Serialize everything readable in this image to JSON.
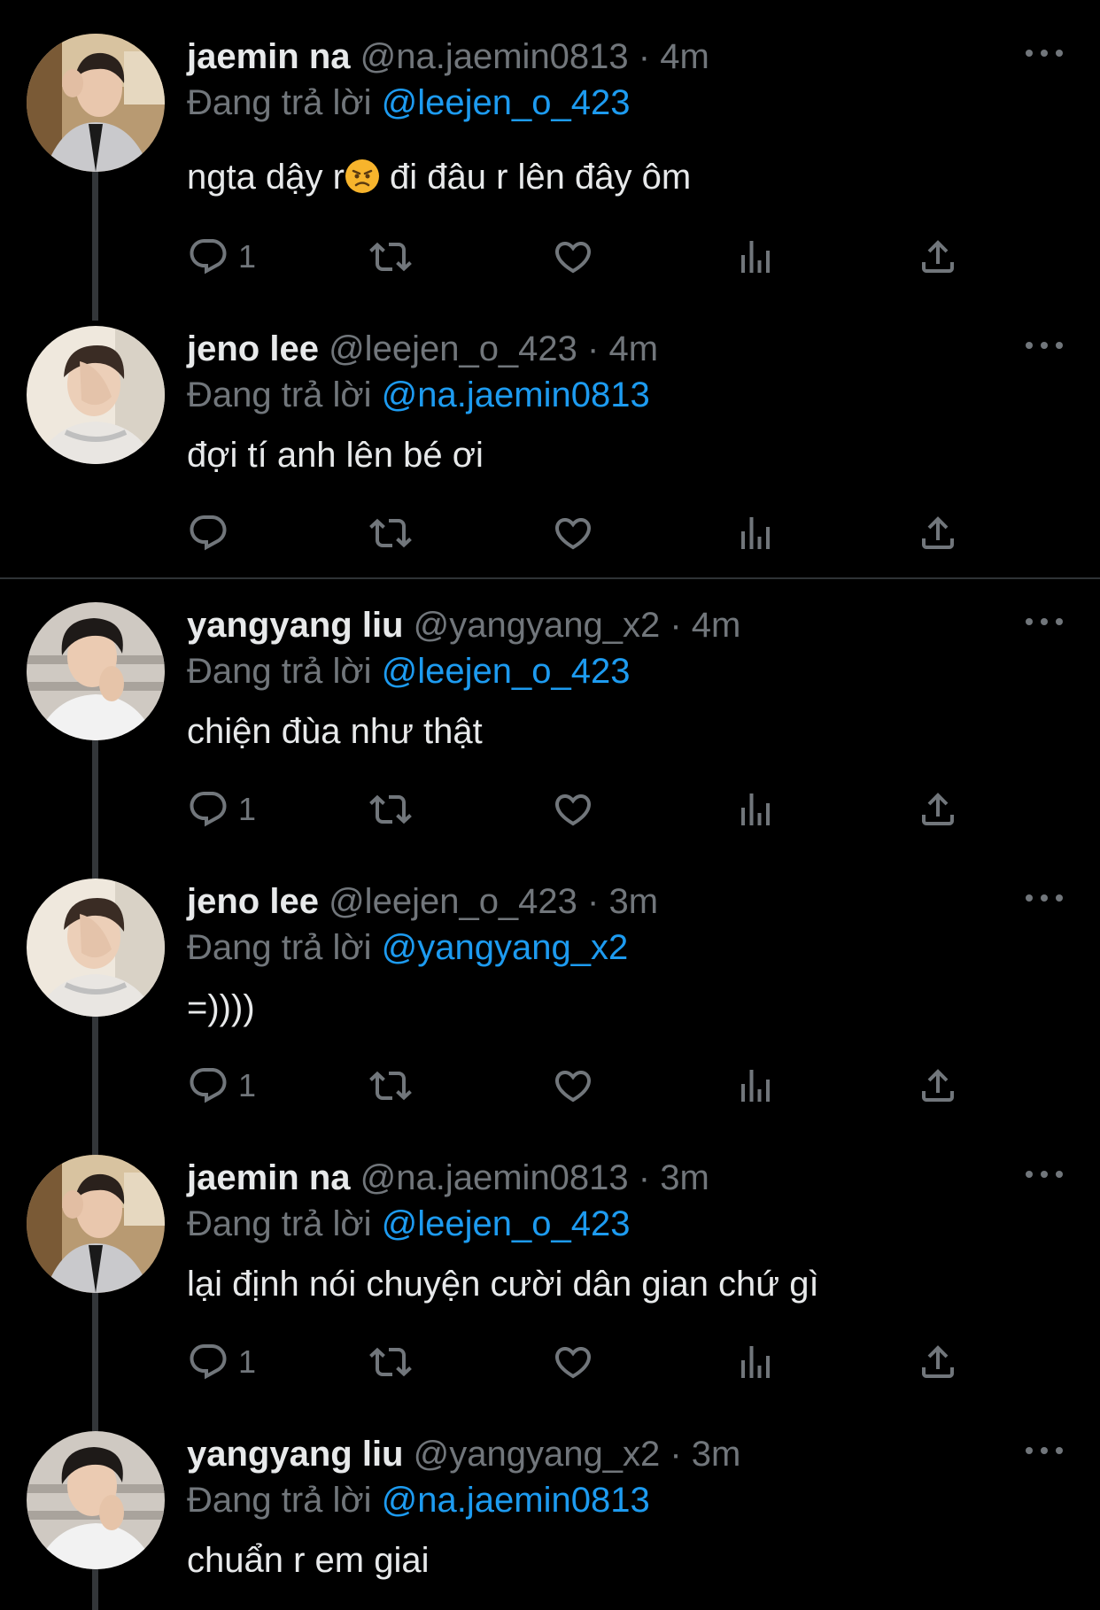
{
  "tweets": [
    {
      "name": "jaemin na",
      "handle": "@na.jaemin0813",
      "separator": "·",
      "time": "4m",
      "replying_prefix": "Đang trả lời",
      "replying_to": "@leejen_o_423",
      "text_before": "ngta dậy r",
      "emoji": "angry-face-emoji",
      "text_after": " đi đâu r lên đây ôm",
      "reply_count": "1"
    },
    {
      "name": "jeno lee",
      "handle": "@leejen_o_423",
      "separator": "·",
      "time": "4m",
      "replying_prefix": "Đang trả lời",
      "replying_to": "@na.jaemin0813",
      "text": "đợi tí anh lên bé ơi",
      "reply_count": ""
    },
    {
      "name": "yangyang liu",
      "handle": "@yangyang_x2",
      "separator": "·",
      "time": "4m",
      "replying_prefix": "Đang trả lời",
      "replying_to": "@leejen_o_423",
      "text": "chiện đùa như thật",
      "reply_count": "1"
    },
    {
      "name": "jeno lee",
      "handle": "@leejen_o_423",
      "separator": "·",
      "time": "3m",
      "replying_prefix": "Đang trả lời",
      "replying_to": "@yangyang_x2",
      "text": "=))))",
      "reply_count": "1"
    },
    {
      "name": "jaemin na",
      "handle": "@na.jaemin0813",
      "separator": "·",
      "time": "3m",
      "replying_prefix": "Đang trả lời",
      "replying_to": "@leejen_o_423",
      "text": "lại định nói chuyện cười dân gian chứ gì",
      "reply_count": "1"
    },
    {
      "name": "yangyang liu",
      "handle": "@yangyang_x2",
      "separator": "·",
      "time": "3m",
      "replying_prefix": "Đang trả lời",
      "replying_to": "@na.jaemin0813",
      "text": "chuẩn r em giai",
      "reply_count": ""
    }
  ],
  "icons": {
    "reply": "reply-icon",
    "retweet": "retweet-icon",
    "like": "heart-icon",
    "views": "views-icon",
    "share": "share-icon",
    "more": "more-icon"
  },
  "colors": {
    "background": "#000000",
    "text": "#e7e9ea",
    "muted": "#71767b",
    "mention": "#1d9bf0",
    "thread_line": "#333639",
    "divider": "#2f3336"
  }
}
